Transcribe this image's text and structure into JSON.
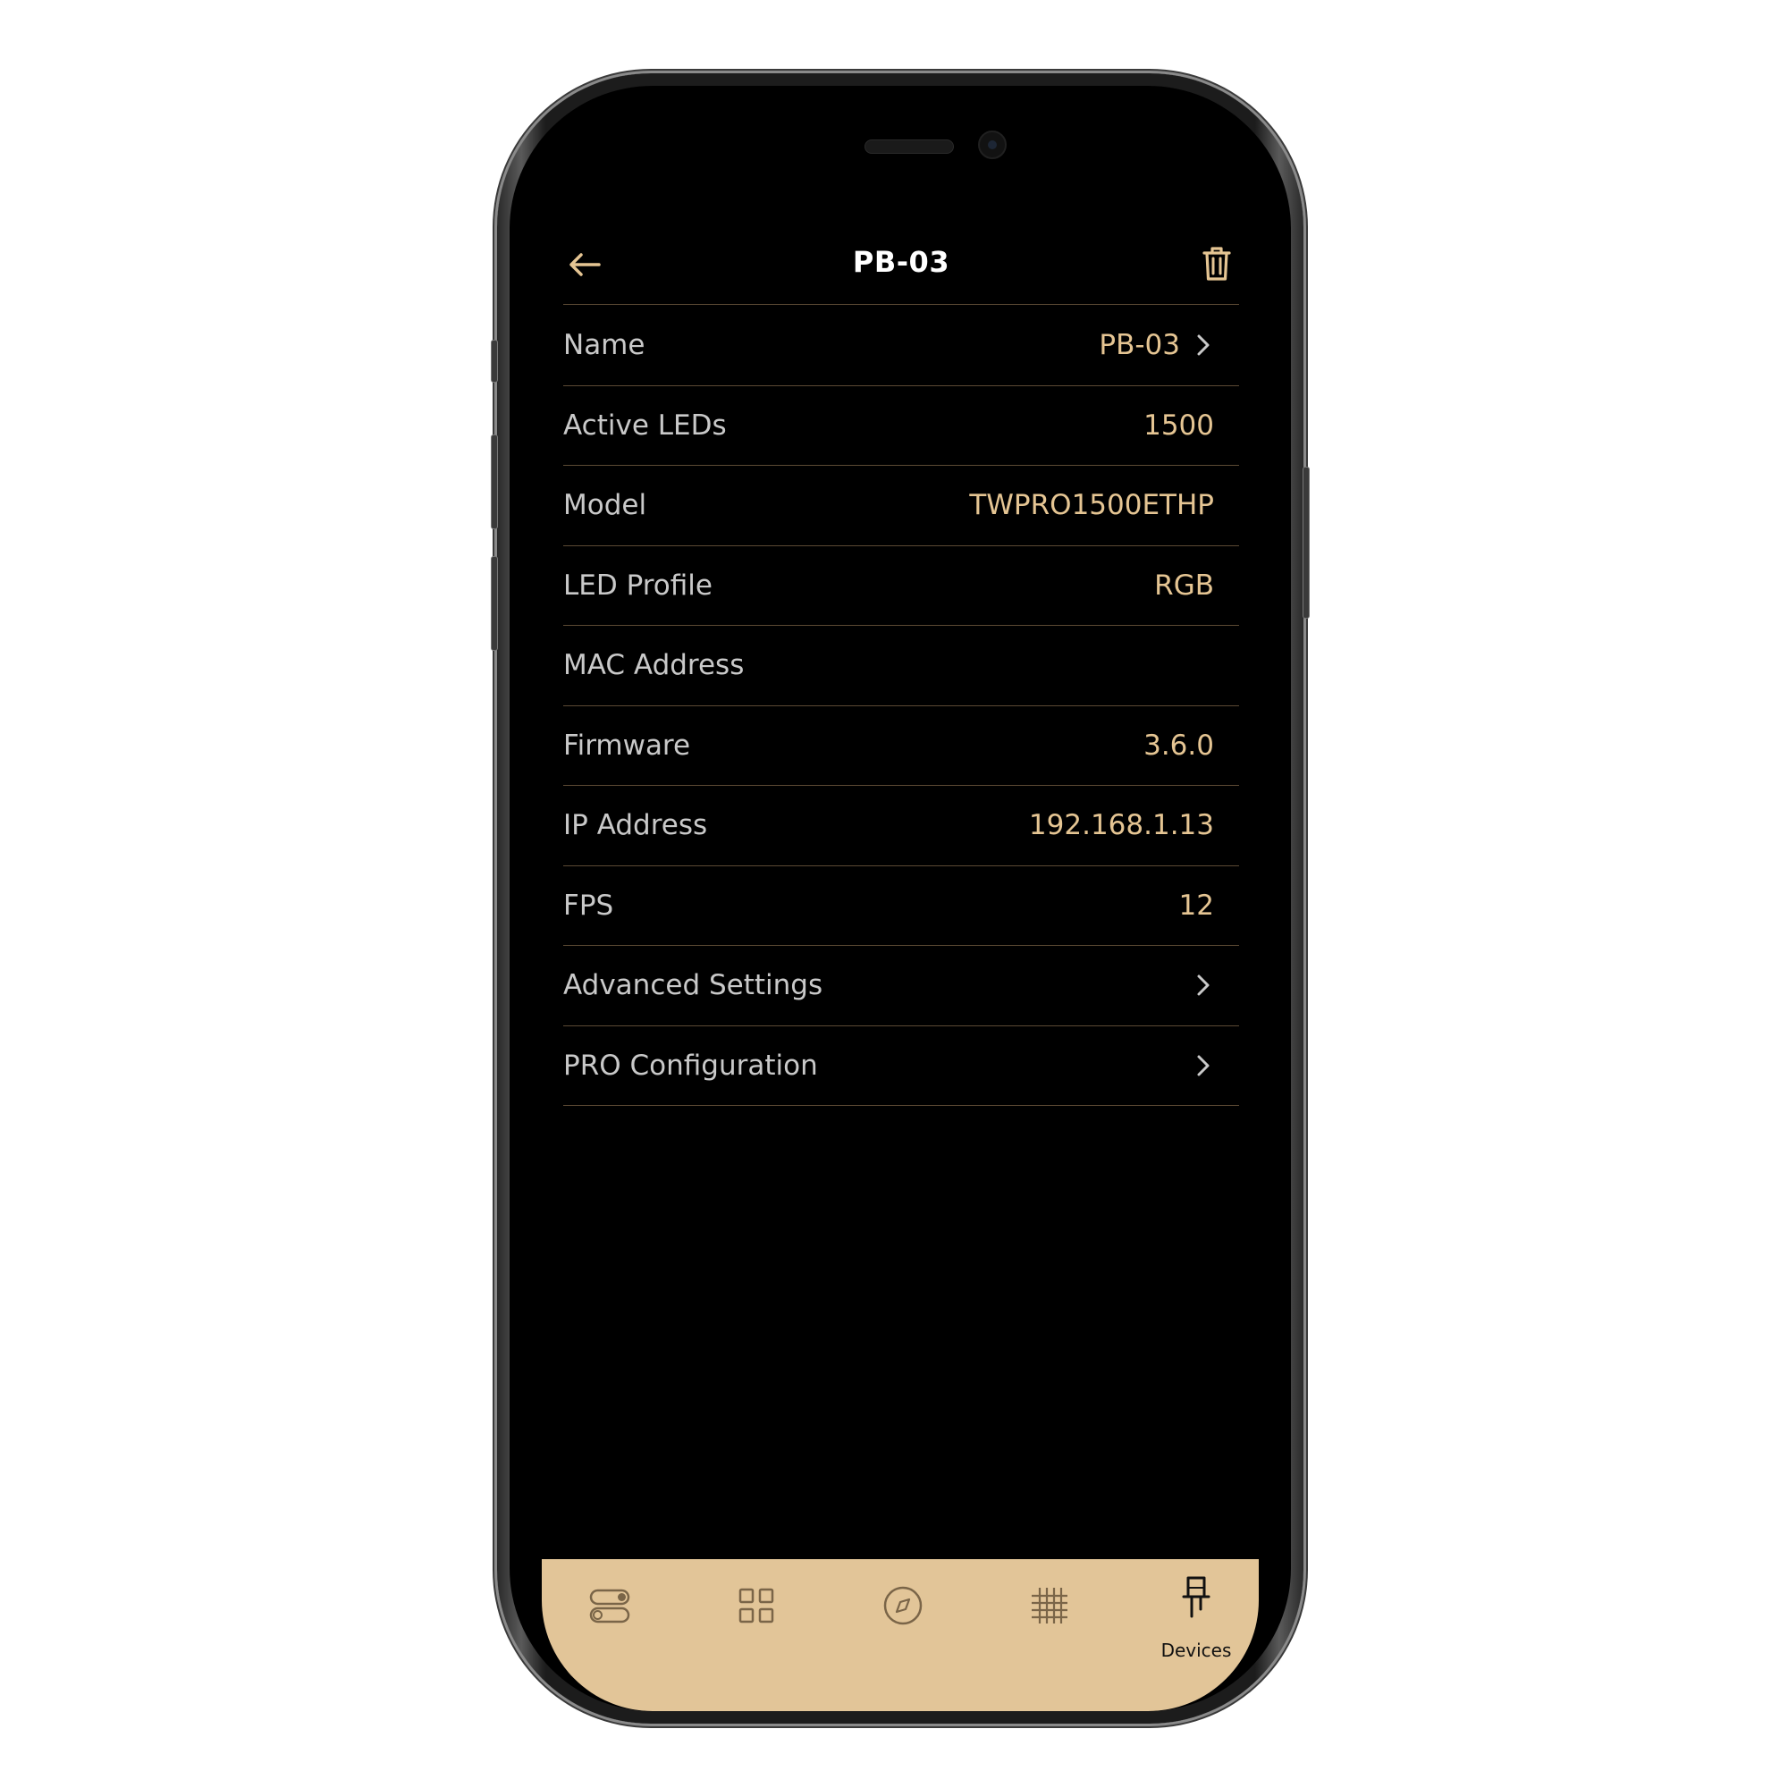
{
  "header": {
    "title": "PB-03",
    "back_icon": "arrow-left-icon",
    "trash_icon": "trash-icon"
  },
  "rows": [
    {
      "label": "Name",
      "value": "PB-03",
      "chevron": true
    },
    {
      "label": "Active LEDs",
      "value": "1500",
      "chevron": false
    },
    {
      "label": "Model",
      "value": "TWPRO1500ETHP",
      "chevron": false
    },
    {
      "label": "LED Profile",
      "value": "RGB",
      "chevron": false
    },
    {
      "label": "MAC Address",
      "value": "",
      "chevron": false
    },
    {
      "label": "Firmware",
      "value": "3.6.0",
      "chevron": false
    },
    {
      "label": "IP Address",
      "value": "192.168.1.13",
      "chevron": false
    },
    {
      "label": "FPS",
      "value": "12",
      "chevron": false
    },
    {
      "label": "Advanced Settings",
      "value": "",
      "chevron": true
    },
    {
      "label": "PRO Configuration",
      "value": "",
      "chevron": true
    }
  ],
  "tabbar": {
    "tabs": [
      {
        "icon": "toggles-icon",
        "label": "",
        "active": false
      },
      {
        "icon": "grid-icon",
        "label": "",
        "active": false
      },
      {
        "icon": "compass-icon",
        "label": "",
        "active": false
      },
      {
        "icon": "hashtag-grid-icon",
        "label": "",
        "active": false
      },
      {
        "icon": "led-device-icon",
        "label": "Devices",
        "active": true
      }
    ]
  },
  "colors": {
    "accent": "#e5c593",
    "tabbar_bg": "#e2c598",
    "divider": "#5c4a34",
    "label_text": "#c9c9c9",
    "background": "#000000"
  }
}
